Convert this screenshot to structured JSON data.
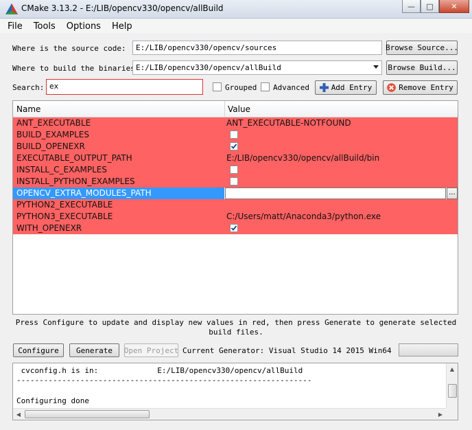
{
  "window": {
    "title": "CMake 3.13.2 - E:/LIB/opencv330/opencv/allBuild",
    "minimize_glyph": "—",
    "maximize_glyph": "□",
    "close_glyph": "✕"
  },
  "menu": [
    "File",
    "Tools",
    "Options",
    "Help"
  ],
  "source": {
    "label": "Where is the source code:",
    "value": "E:/LIB/opencv330/opencv/sources",
    "browse": "Browse Source..."
  },
  "binaries": {
    "label": "Where to build the binaries:",
    "value": "E:/LIB/opencv330/opencv/allBuild",
    "browse": "Browse Build..."
  },
  "search": {
    "label": "Search:",
    "value": "ex",
    "grouped_label": "Grouped",
    "advanced_label": "Advanced",
    "add_entry": "Add Entry",
    "remove_entry": "Remove Entry"
  },
  "table": {
    "headers": [
      "Name",
      "Value"
    ],
    "rows": [
      {
        "name": "ANT_EXECUTABLE",
        "value": "ANT_EXECUTABLE-NOTFOUND",
        "kind": "text"
      },
      {
        "name": "BUILD_EXAMPLES",
        "value": "",
        "kind": "bool",
        "checked": false
      },
      {
        "name": "BUILD_OPENEXR",
        "value": "",
        "kind": "bool",
        "checked": true
      },
      {
        "name": "EXECUTABLE_OUTPUT_PATH",
        "value": "E:/LIB/opencv330/opencv/allBuild/bin",
        "kind": "text"
      },
      {
        "name": "INSTALL_C_EXAMPLES",
        "value": "",
        "kind": "bool",
        "checked": false
      },
      {
        "name": "INSTALL_PYTHON_EXAMPLES",
        "value": "",
        "kind": "bool",
        "checked": false
      },
      {
        "name": "OPENCV_EXTRA_MODULES_PATH",
        "value": "",
        "kind": "editing"
      },
      {
        "name": "PYTHON2_EXECUTABLE",
        "value": "",
        "kind": "text"
      },
      {
        "name": "PYTHON3_EXECUTABLE",
        "value": "C:/Users/matt/Anaconda3/python.exe",
        "kind": "text"
      },
      {
        "name": "WITH_OPENEXR",
        "value": "",
        "kind": "bool",
        "checked": true
      }
    ],
    "browse_glyph": "..."
  },
  "info": "Press Configure to update and display new values in red, then press Generate to generate selected build files.",
  "actions": {
    "configure": "Configure",
    "generate": "Generate",
    "open_project": "Open Project",
    "generator": "Current Generator: Visual Studio 14 2015 Win64"
  },
  "output": {
    "lines": [
      " cvconfig.h is in:             E:/LIB/opencv330/opencv/allBuild",
      "-----------------------------------------------------------------",
      "",
      "Configuring done"
    ]
  },
  "colors": {
    "new_entry_red": "#ff6262",
    "selection_blue": "#3399ff"
  }
}
